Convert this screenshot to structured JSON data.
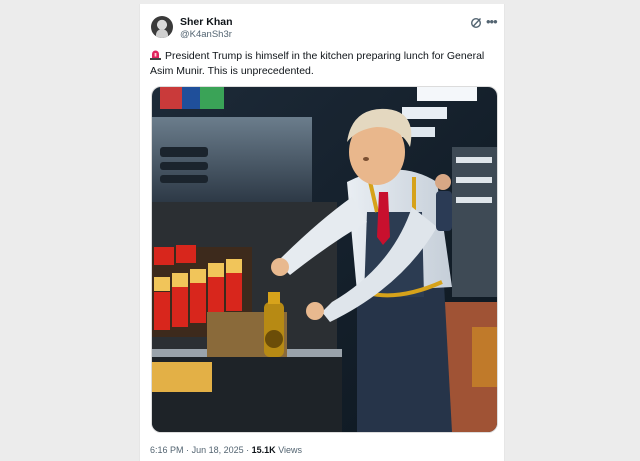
{
  "author": {
    "name": "Sher Khan",
    "handle": "@K4anSh3r"
  },
  "tweet": {
    "text": "President Trump is himself in the kitchen preparing lunch for General Asim Munir. This is unprecedented.",
    "emoji_icon": "siren-icon"
  },
  "media": {
    "icon": "photo"
  },
  "meta": {
    "time": "6:16 PM",
    "separator": "·",
    "date": "Jun 18, 2025",
    "views_count": "15.1K",
    "views_label": "Views"
  },
  "colors": {
    "text": "#0f1419",
    "secondary": "#536471",
    "background": "#ffffff"
  }
}
